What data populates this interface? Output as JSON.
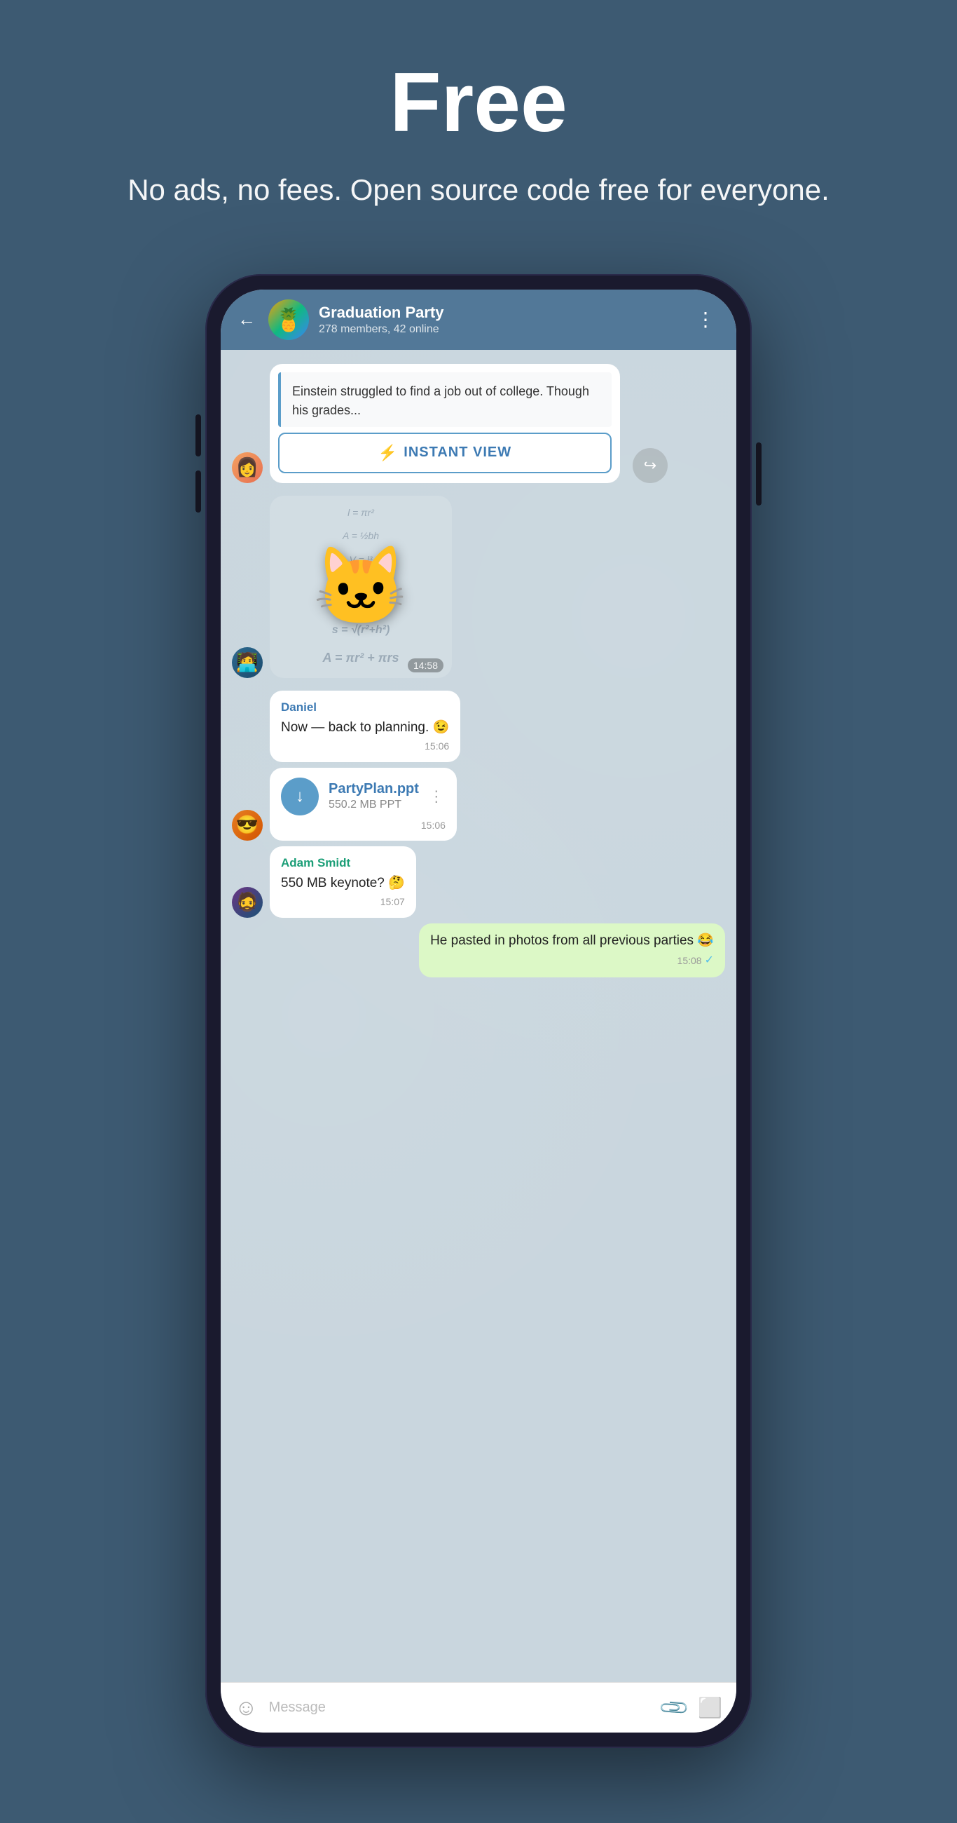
{
  "hero": {
    "title": "Free",
    "subtitle": "No ads, no fees. Open source code free for everyone."
  },
  "chat": {
    "header": {
      "back_label": "←",
      "group_name": "Graduation Party",
      "group_meta": "278 members, 42 online",
      "avatar_emoji": "🍍",
      "menu_dots": "⋮"
    },
    "messages": [
      {
        "id": "article",
        "type": "article",
        "text": "Einstein struggled to find a job out of college. Though his grades...",
        "instant_view_label": "INSTANT VIEW",
        "avatar_type": "female",
        "avatar_emoji": "👩"
      },
      {
        "id": "sticker",
        "type": "sticker",
        "time": "14:58",
        "avatar_type": "male1",
        "avatar_emoji": "🧑"
      },
      {
        "id": "daniel-msg",
        "type": "text",
        "sender": "Daniel",
        "sender_color": "blue",
        "text": "Now — back to planning. 😉",
        "time": "15:06"
      },
      {
        "id": "file-msg",
        "type": "file",
        "file_name": "PartyPlan.ppt",
        "file_size": "550.2 MB PPT",
        "time": "15:06",
        "avatar_type": "male2",
        "avatar_emoji": "😎"
      },
      {
        "id": "adam-msg",
        "type": "text",
        "sender": "Adam Smidt",
        "sender_color": "teal",
        "text": "550 MB keynote? 🤔",
        "time": "15:07",
        "avatar_type": "male3",
        "avatar_emoji": "🧔"
      },
      {
        "id": "own-msg",
        "type": "own",
        "text": "He pasted in photos from all previous parties 😂",
        "time": "15:08",
        "is_read": true
      }
    ],
    "input": {
      "placeholder": "Message",
      "emoji_icon": "☺",
      "attach_icon": "📎",
      "camera_icon": "📷"
    }
  }
}
